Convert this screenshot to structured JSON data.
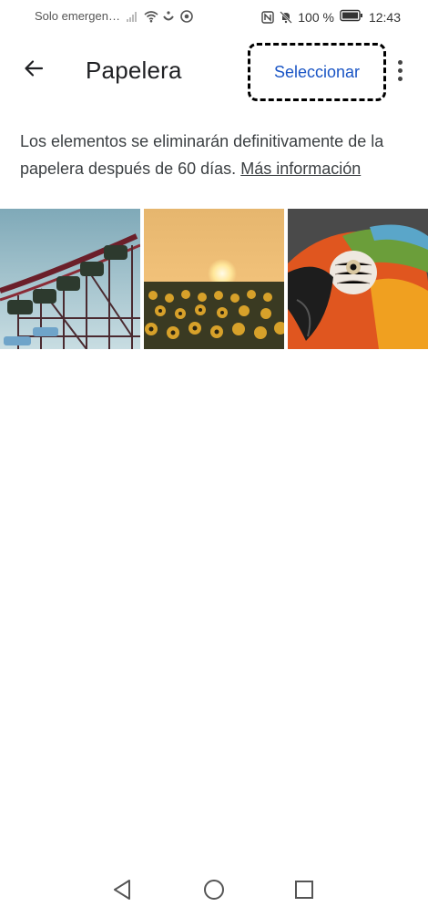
{
  "status_bar": {
    "carrier": "Solo emergen…",
    "battery": "100 %",
    "time": "12:43"
  },
  "app_bar": {
    "title": "Papelera",
    "select_label": "Seleccionar"
  },
  "info": {
    "text": "Los elementos se eliminarán definitivamente de la papelera después de 60 días.",
    "link": "Más información"
  },
  "photos": [
    {
      "subject": "roller-coaster"
    },
    {
      "subject": "sunflowers-sunset"
    },
    {
      "subject": "macaw-parrot"
    }
  ],
  "icons": {
    "back": "arrow-left-icon",
    "more": "more-vert-icon",
    "nav_back": "triangle-back-icon",
    "nav_home": "circle-home-icon",
    "nav_recents": "square-recents-icon"
  },
  "colors": {
    "accent": "#1a55c5",
    "text": "#3c4043"
  }
}
